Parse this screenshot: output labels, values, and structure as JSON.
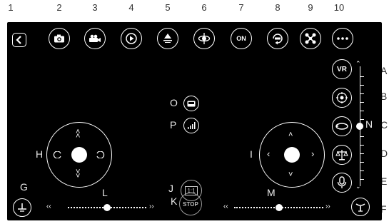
{
  "top_labels": [
    "1",
    "2",
    "3",
    "4",
    "5",
    "6",
    "7",
    "8",
    "9",
    "10"
  ],
  "side_labels": [
    "A",
    "B",
    "C",
    "D",
    "E",
    "F"
  ],
  "panel_labels": {
    "g": "G",
    "h": "H",
    "i": "I",
    "j": "J",
    "k": "K",
    "l": "L",
    "m": "M",
    "n": "N",
    "o": "O",
    "p": "P"
  },
  "buttons": {
    "on_label": "ON",
    "vr_label": "VR",
    "stop_label": "STOP",
    "ratio_label": "1:1"
  },
  "sliders": {
    "left_level": 0.5,
    "right_level": 0.5,
    "vertical_level": 0.5
  }
}
